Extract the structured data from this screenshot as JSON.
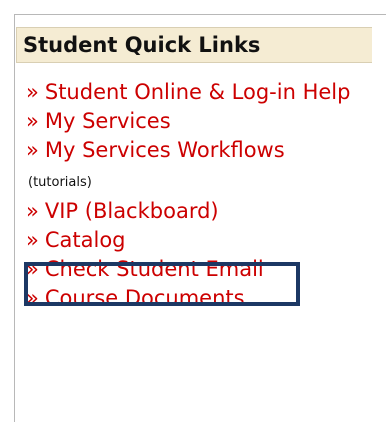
{
  "panel": {
    "title": "Student Quick Links",
    "bullet": "»",
    "links": [
      {
        "label": "Student Online & Log-in Help"
      },
      {
        "label": "My Services"
      },
      {
        "label": "My Services Workflows",
        "note": "(tutorials)"
      },
      {
        "label": "VIP (Blackboard)",
        "highlighted": true
      },
      {
        "label": "Catalog"
      },
      {
        "label": "Check Student Email"
      },
      {
        "label": "Course Documents"
      }
    ]
  },
  "colors": {
    "link": "#cc0000",
    "header_bg": "#f5ecd3",
    "highlight_border": "#1c3864"
  }
}
